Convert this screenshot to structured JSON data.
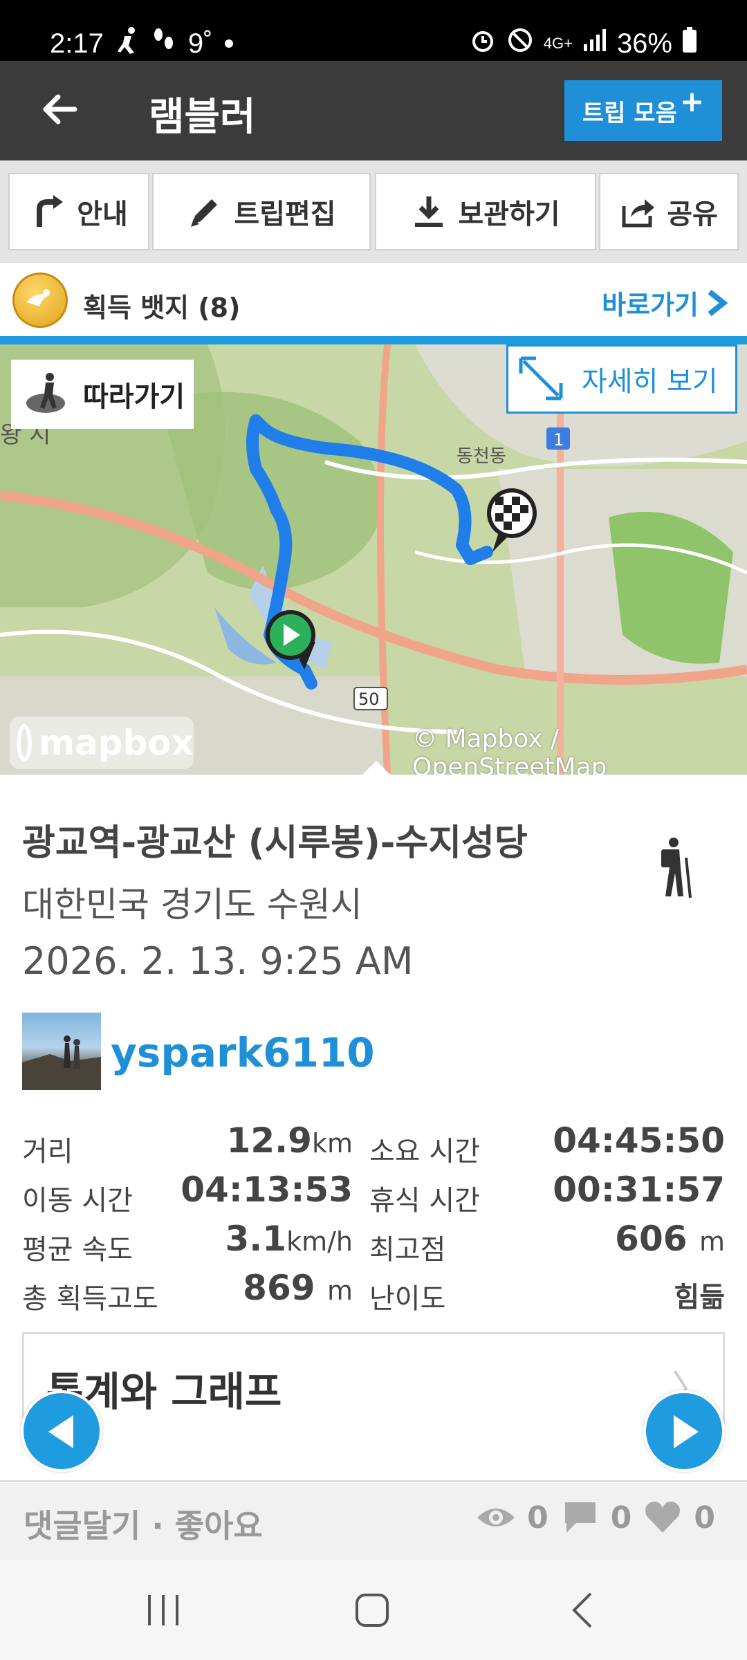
{
  "status_bar": {
    "time": "2:17",
    "temp": "9˚",
    "network": "4G+",
    "battery": "36%"
  },
  "app_bar": {
    "title": "램블러",
    "trip_collection_label": "트립 모음"
  },
  "toolbar": {
    "guide_label": "안내",
    "edit_label": "트립편집",
    "save_label": "보관하기",
    "share_label": "공유"
  },
  "badges": {
    "label": "획득 뱃지 (8)",
    "shortcut_label": "바로가기"
  },
  "map": {
    "follow_label": "따라가기",
    "detail_label": "자세히 보기",
    "logo_text": "mapbox",
    "attribution": "© Mapbox / OpenStreetMap",
    "place_label": "동천동",
    "route_shield_1": "1",
    "route_shield_50": "50",
    "edge_label": "왕 시",
    "route_color": "#1f7ee8"
  },
  "trip": {
    "name": "광교역-광교산 (시루봉)-수지성당",
    "location": "대한민국 경기도 수원시",
    "datetime": "2026. 2. 13. 9:25 AM",
    "username": "yspark6110"
  },
  "stats": {
    "distance_label": "거리",
    "distance_value": "12.9",
    "distance_unit": "km",
    "duration_label": "소요 시간",
    "duration_value": "04:45:50",
    "moving_label": "이동 시간",
    "moving_value": "04:13:53",
    "rest_label": "휴식 시간",
    "rest_value": "00:31:57",
    "speed_label": "평균 속도",
    "speed_value": "3.1",
    "speed_unit": "km/h",
    "max_alt_label": "최고점",
    "max_alt_value": "606",
    "max_alt_unit": "m",
    "gain_label": "총 획득고도",
    "gain_value": "869",
    "gain_unit": "m",
    "difficulty_label": "난이도",
    "difficulty_value": "힘듦"
  },
  "stats_button": {
    "label": "통계와 그래프"
  },
  "bottom": {
    "comment_like_label": "댓글달기 · 좋아요",
    "views": "0",
    "comments": "0",
    "likes": "0"
  }
}
